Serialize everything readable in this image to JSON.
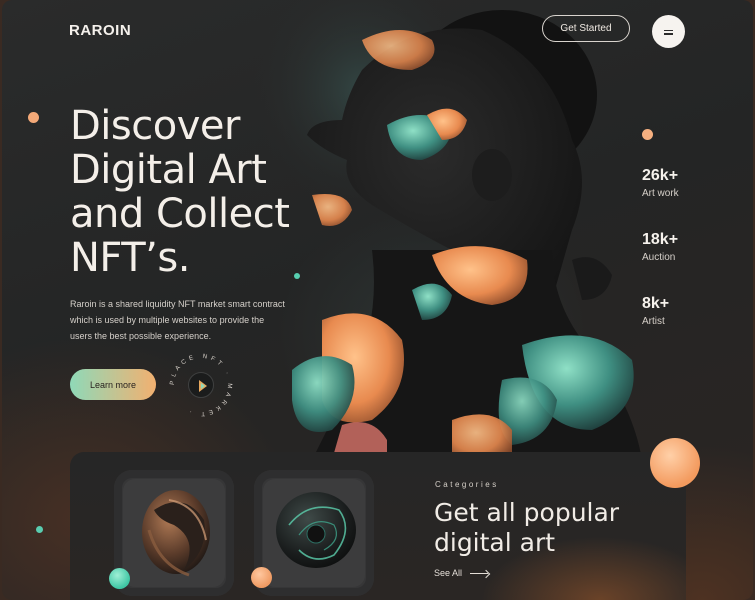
{
  "brand": {
    "logo": "RAROIN"
  },
  "header": {
    "cta_label": "Get Started",
    "menu_icon": "menu-icon"
  },
  "hero": {
    "title_lines": [
      "Discover",
      "Digital Art",
      "and Collect",
      "NFT’s."
    ],
    "description": "Raroin is a shared liquidity NFT market smart contract which is used by multiple websites to provide the users the best possible experience.",
    "learn_more_label": "Learn more",
    "badge_text": "PLACE NFT · MARKET · "
  },
  "stats": [
    {
      "value": "26k+",
      "label": "Art work"
    },
    {
      "value": "18k+",
      "label": "Auction"
    },
    {
      "value": "8k+",
      "label": "Artist"
    }
  ],
  "categories": {
    "eyebrow": "Categories",
    "title_lines": [
      "Get all popular",
      "digital art"
    ],
    "see_all_label": "See All"
  },
  "colors": {
    "accent_orange": "#f2a46a",
    "accent_teal": "#5fd3b2",
    "background": "#262727"
  }
}
